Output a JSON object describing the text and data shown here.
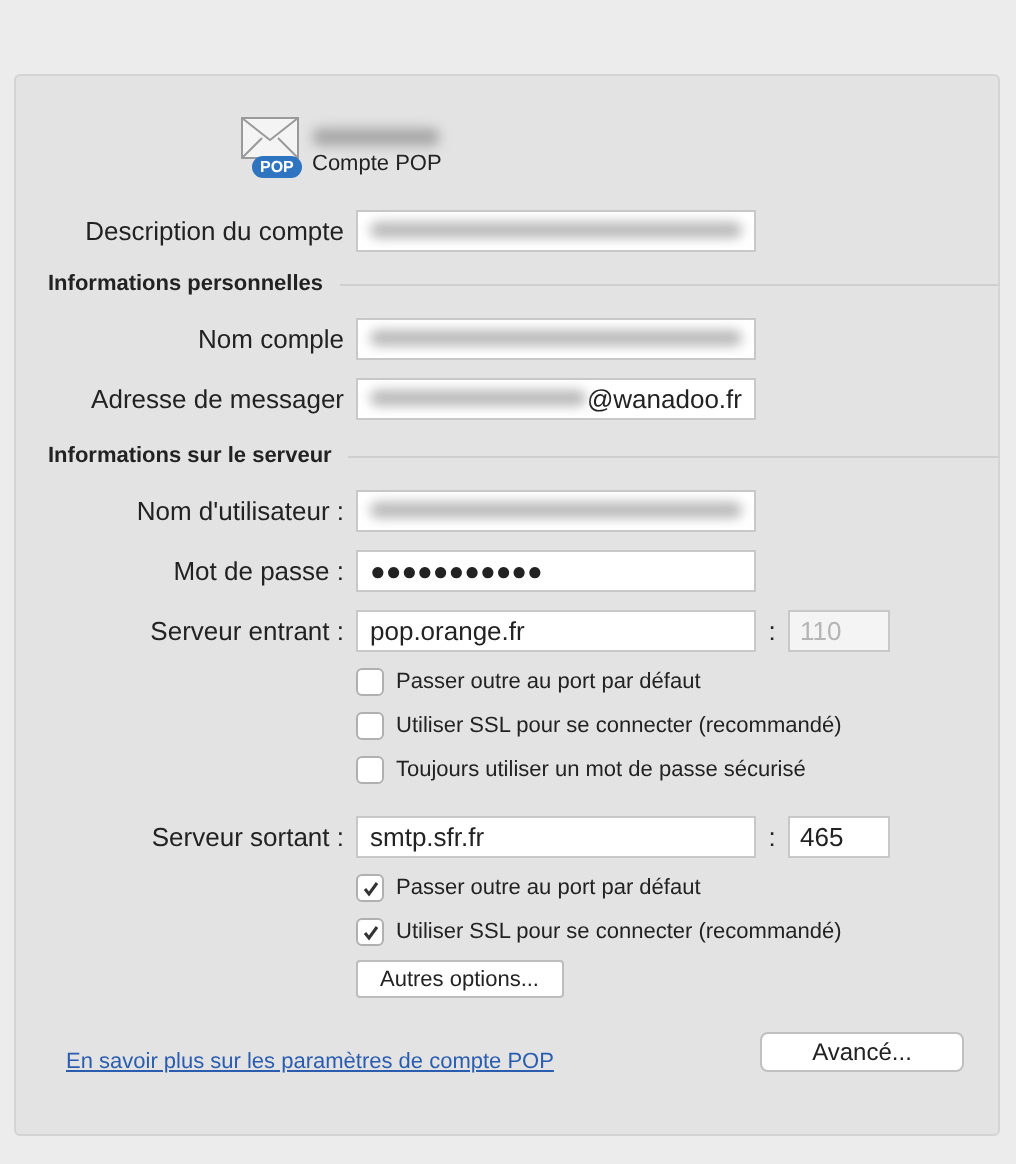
{
  "header": {
    "icon_badge": "POP",
    "name_redacted": true,
    "subtitle": "Compte POP"
  },
  "description": {
    "label": "Description du compte",
    "redacted": true
  },
  "sections": [
    {
      "title": "Informations personnelles",
      "fields": [
        {
          "kind": "text",
          "label": "Nom comple",
          "redacted": true
        },
        {
          "kind": "text",
          "label": "Adresse de messager",
          "redacted": true,
          "value": "@wanadoo.fr"
        }
      ]
    },
    {
      "title": "Informations sur le serveur",
      "fields": [
        {
          "kind": "text",
          "label": "Nom d'utilisateur :",
          "redacted": true
        },
        {
          "kind": "text",
          "label": "Mot de passe :",
          "redacted": false,
          "value": "●●●●●●●●●●●"
        },
        {
          "kind": "server",
          "label": "Serveur entrant :",
          "redacted": false,
          "value": "pop.orange.fr",
          "port_separator": ":",
          "port": {
            "value": "110",
            "disabled": true
          },
          "options": [
            {
              "label": "Passer outre au port par défaut",
              "checked": false
            },
            {
              "label": "Utiliser SSL pour se connecter (recommandé)",
              "checked": false
            },
            {
              "label": "Toujours utiliser un mot de passe sécurisé",
              "checked": false
            }
          ]
        },
        {
          "kind": "server",
          "label": "Serveur sortant :",
          "redacted": false,
          "value": "smtp.sfr.fr",
          "port_separator": ":",
          "port": {
            "value": "465",
            "disabled": false
          },
          "options": [
            {
              "label": "Passer outre au port par défaut",
              "checked": true
            },
            {
              "label": "Utiliser SSL pour se connecter (recommandé)",
              "checked": true
            }
          ],
          "button": "Autres options..."
        }
      ]
    }
  ],
  "footer": {
    "link": "En savoir plus sur les paramètres de compte POP",
    "button": "Avancé..."
  }
}
